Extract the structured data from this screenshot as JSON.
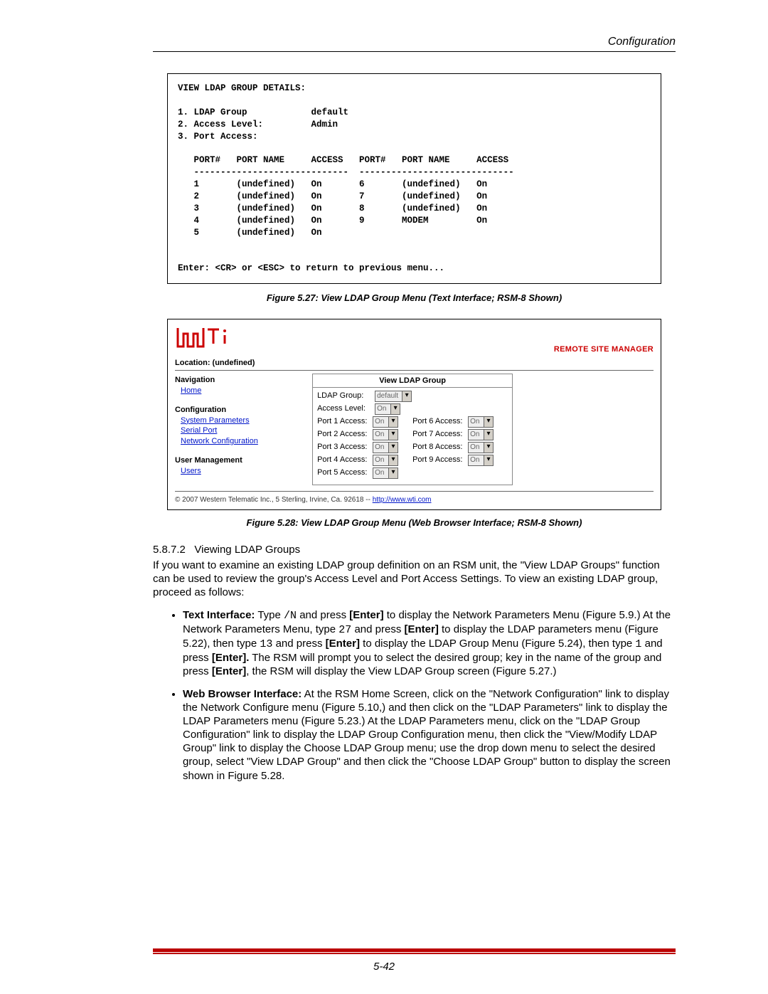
{
  "header": {
    "section": "Configuration"
  },
  "text_panel": {
    "title": "VIEW LDAP GROUP DETAILS:",
    "fields": [
      {
        "n": "1.",
        "label": "LDAP Group",
        "value": "default"
      },
      {
        "n": "2.",
        "label": "Access Level:",
        "value": "Admin"
      },
      {
        "n": "3.",
        "label": "Port Access:",
        "value": ""
      }
    ],
    "col_headers": [
      "PORT#",
      "PORT NAME",
      "ACCESS",
      "PORT#",
      "PORT NAME",
      "ACCESS"
    ],
    "rows": [
      {
        "l": [
          "1",
          "(undefined)",
          "On"
        ],
        "r": [
          "6",
          "(undefined)",
          "On"
        ]
      },
      {
        "l": [
          "2",
          "(undefined)",
          "On"
        ],
        "r": [
          "7",
          "(undefined)",
          "On"
        ]
      },
      {
        "l": [
          "3",
          "(undefined)",
          "On"
        ],
        "r": [
          "8",
          "(undefined)",
          "On"
        ]
      },
      {
        "l": [
          "4",
          "(undefined)",
          "On"
        ],
        "r": [
          "9",
          "MODEM",
          "On"
        ]
      },
      {
        "l": [
          "5",
          "(undefined)",
          "On"
        ],
        "r": [
          "",
          "",
          ""
        ]
      }
    ],
    "prompt": "Enter: <CR> or <ESC> to return to previous menu..."
  },
  "caption1": "Figure 5.27:  View LDAP Group Menu (Text Interface; RSM-8 Shown)",
  "browser": {
    "brand_label": "REMOTE SITE MANAGER",
    "location": "Location: (undefined)",
    "nav": {
      "nav_heading": "Navigation",
      "home": "Home",
      "config_heading": "Configuration",
      "sys_params": "System Parameters",
      "serial_port": "Serial Port",
      "net_config": "Network Configuration",
      "user_mgmt_heading": "User Management",
      "users": "Users"
    },
    "form": {
      "title": "View LDAP Group",
      "ldap_group_label": "LDAP Group:",
      "ldap_group_value": "default",
      "access_level_label": "Access Level:",
      "access_level_value": "On",
      "ports_left": [
        {
          "label": "Port 1 Access:",
          "value": "On"
        },
        {
          "label": "Port 2 Access:",
          "value": "On"
        },
        {
          "label": "Port 3 Access:",
          "value": "On"
        },
        {
          "label": "Port 4 Access:",
          "value": "On"
        },
        {
          "label": "Port 5 Access:",
          "value": "On"
        }
      ],
      "ports_right": [
        {
          "label": "Port 6 Access:",
          "value": "On"
        },
        {
          "label": "Port 7 Access:",
          "value": "On"
        },
        {
          "label": "Port 8 Access:",
          "value": "On"
        },
        {
          "label": "Port 9 Access:",
          "value": "On"
        }
      ]
    },
    "footer_text": "© 2007 Western Telematic Inc., 5 Sterling, Irvine, Ca. 92618 -- ",
    "footer_link": "http://www.wti.com"
  },
  "caption2": "Figure 5.28:  View LDAP Group Menu (Web Browser Interface; RSM-8 Shown)",
  "section": {
    "number": "5.8.7.2",
    "title": "Viewing LDAP Groups",
    "intro": "If you want to examine an existing LDAP group definition on an RSM unit, the \"View LDAP Groups\" function can be used to review the group's Access Level and Port Access Settings.  To view an existing LDAP group, proceed as follows:",
    "bullets": {
      "ti_lead": "Text Interface:",
      "ti_rest1": "  Type ",
      "ti_code1": "/N",
      "ti_rest2": " and press ",
      "ti_enter": "[Enter]",
      "ti_rest3": " to display the Network Parameters Menu (Figure 5.9.)  At the Network Parameters Menu, type ",
      "ti_code2": "27",
      "ti_rest4": " and press ",
      "ti_rest5": " to display the LDAP parameters menu (Figure 5.22), then type ",
      "ti_code3": "13",
      "ti_rest6": " and press ",
      "ti_rest7": " to display the LDAP Group Menu (Figure 5.24), then type ",
      "ti_code4": "1",
      "ti_rest8": " and press ",
      "ti_enter_dot": "[Enter].",
      "ti_rest9": "  The RSM will prompt you to select the desired group; key in the name of the group and press ",
      "ti_rest10": ", the RSM will display the View LDAP Group screen (Figure 5.27.)",
      "wb_lead": "Web Browser Interface:",
      "wb_rest": "  At the RSM Home Screen, click on the \"Network Configuration\" link to display the Network Configure menu (Figure 5.10,) and then click on the \"LDAP Parameters\" link to display the LDAP Parameters menu (Figure 5.23.)  At the LDAP Parameters menu, click on the \"LDAP Group Configuration\" link to display the LDAP Group Configuration menu, then click the \"View/Modify LDAP Group\" link to display the Choose LDAP Group menu; use the drop down menu to select the desired group, select \"View LDAP Group\" and then click the \"Choose LDAP Group\" button to display the screen shown in Figure 5.28."
    }
  },
  "page_number": "5-42"
}
